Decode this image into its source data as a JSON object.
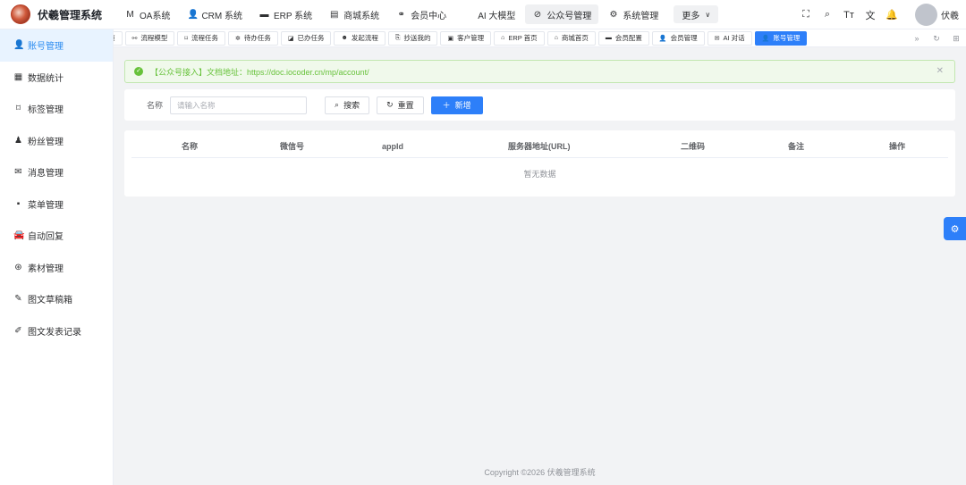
{
  "app": {
    "title": "伏羲管理系统"
  },
  "topnav": [
    {
      "label": "OA系统",
      "icon": "oa-icon",
      "glyph": "M",
      "active": false
    },
    {
      "label": "CRM 系统",
      "icon": "user-icon",
      "glyph": "👤",
      "active": false
    },
    {
      "label": "ERP 系统",
      "icon": "erp-icon",
      "glyph": "▬",
      "active": false
    },
    {
      "label": "商城系统",
      "icon": "shop-icon",
      "glyph": "▤",
      "active": false
    },
    {
      "label": "会员中心",
      "icon": "bike-icon",
      "glyph": "⚭",
      "active": false
    },
    {
      "label": "AI 大模型",
      "icon": "apple-icon",
      "glyph": "",
      "active": false
    },
    {
      "label": "公众号管理",
      "icon": "compass-icon",
      "glyph": "⊘",
      "active": true
    },
    {
      "label": "系统管理",
      "icon": "gear-icon",
      "glyph": "⚙",
      "active": false
    }
  ],
  "topnav_more": "更多",
  "header_tools": [
    {
      "icon": "fullscreen-icon",
      "glyph": "⛶"
    },
    {
      "icon": "search-icon",
      "glyph": "⌕"
    },
    {
      "icon": "font-size-icon",
      "glyph": "Tт"
    },
    {
      "icon": "translate-icon",
      "glyph": "文"
    },
    {
      "icon": "bell-icon",
      "glyph": "🔔"
    }
  ],
  "user": {
    "name": "伏羲"
  },
  "sidebar": [
    {
      "label": "账号管理",
      "icon": "user-icon",
      "glyph": "👤",
      "active": true
    },
    {
      "label": "数据统计",
      "icon": "chart-icon",
      "glyph": "▦",
      "active": false
    },
    {
      "label": "标签管理",
      "icon": "bookmark-icon",
      "glyph": "⌑",
      "active": false
    },
    {
      "label": "粉丝管理",
      "icon": "fans-icon",
      "glyph": "♟",
      "active": false
    },
    {
      "label": "消息管理",
      "icon": "mail-icon",
      "glyph": "✉",
      "active": false
    },
    {
      "label": "菜单管理",
      "icon": "grid-icon",
      "glyph": "▪",
      "active": false
    },
    {
      "label": "自动回复",
      "icon": "robot-icon",
      "glyph": "🚘",
      "active": false
    },
    {
      "label": "素材管理",
      "icon": "material-icon",
      "glyph": "⊛",
      "active": false
    },
    {
      "label": "图文草稿箱",
      "icon": "edit-icon",
      "glyph": "✎",
      "active": false
    },
    {
      "label": "图文发表记录",
      "icon": "pen-icon",
      "glyph": "✐",
      "active": false
    }
  ],
  "tabs": [
    {
      "label": "项",
      "icon": "",
      "glyph": "",
      "active": false
    },
    {
      "label": "流程模型",
      "icon": "flow-icon",
      "glyph": "⚯",
      "active": false
    },
    {
      "label": "流程任务",
      "icon": "bookmark-icon",
      "glyph": "⌑",
      "active": false
    },
    {
      "label": "待办任务",
      "icon": "todo-icon",
      "glyph": "✲",
      "active": false
    },
    {
      "label": "已办任务",
      "icon": "done-icon",
      "glyph": "◪",
      "active": false
    },
    {
      "label": "发起流程",
      "icon": "start-icon",
      "glyph": "☻",
      "active": false
    },
    {
      "label": "抄送我的",
      "icon": "copy-icon",
      "glyph": "⎘",
      "active": false
    },
    {
      "label": "客户管理",
      "icon": "customer-icon",
      "glyph": "▣",
      "active": false
    },
    {
      "label": "ERP 首页",
      "icon": "home-icon",
      "glyph": "⌂",
      "active": false
    },
    {
      "label": "商城首页",
      "icon": "home-icon",
      "glyph": "⌂",
      "active": false
    },
    {
      "label": "会员配置",
      "icon": "config-icon",
      "glyph": "▬",
      "active": false
    },
    {
      "label": "会员管理",
      "icon": "user-icon",
      "glyph": "👤",
      "active": false
    },
    {
      "label": "AI 对话",
      "icon": "chat-icon",
      "glyph": "✉",
      "active": false
    },
    {
      "label": "账号管理",
      "icon": "user-icon",
      "glyph": "👤",
      "active": true
    }
  ],
  "alert": {
    "text": "【公众号接入】文档地址：https://doc.iocoder.cn/mp/account/"
  },
  "search": {
    "label": "名称",
    "placeholder": "请输入名称",
    "search_label": "搜索",
    "reset_label": "重置",
    "add_label": "新增"
  },
  "table": {
    "columns": [
      "名称",
      "微信号",
      "appId",
      "服务器地址(URL)",
      "二维码",
      "备注",
      "操作"
    ],
    "empty_text": "暂无数据"
  },
  "footer": {
    "text": "Copyright ©2026 伏羲管理系统"
  },
  "colors": {
    "primary": "#2d7ff9",
    "success": "#67c23a",
    "sidebar_active_bg": "#e8f3ff"
  }
}
